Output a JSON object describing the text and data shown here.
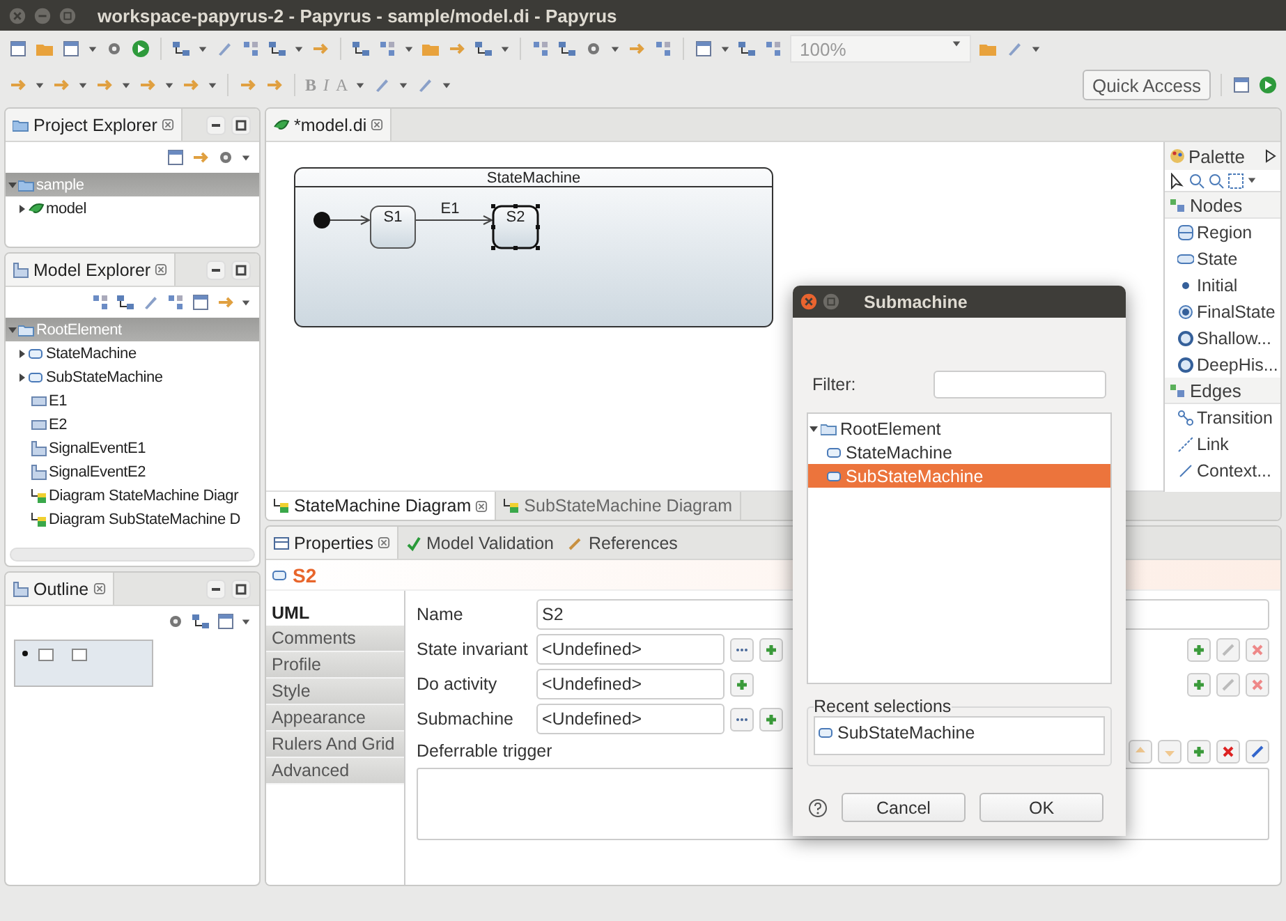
{
  "window": {
    "title": "workspace-papyrus-2 - Papyrus - sample/model.di - Papyrus"
  },
  "toolbar": {
    "format_buttons": [
      "B",
      "I",
      "A"
    ],
    "zoom": "100%",
    "quick_access": "Quick Access"
  },
  "project_explorer": {
    "title": "Project Explorer",
    "tree": [
      {
        "label": "sample",
        "kind": "project",
        "selected": true,
        "expanded": true,
        "children": [
          {
            "label": "model",
            "kind": "model",
            "selected": false,
            "expanded": false
          }
        ]
      }
    ]
  },
  "model_explorer": {
    "title": "Model Explorer",
    "tree": [
      {
        "label": "RootElement",
        "kind": "package",
        "selected": true,
        "expanded": true,
        "children": [
          {
            "label": "StateMachine",
            "kind": "statemachine",
            "selected": false,
            "expanded": false
          },
          {
            "label": "SubStateMachine",
            "kind": "statemachine",
            "selected": false,
            "expanded": false
          },
          {
            "label": "E1",
            "kind": "event",
            "selected": false
          },
          {
            "label": "E2",
            "kind": "event",
            "selected": false
          },
          {
            "label": "SignalEventE1",
            "kind": "signal",
            "selected": false
          },
          {
            "label": "SignalEventE2",
            "kind": "signal",
            "selected": false
          },
          {
            "label": "Diagram StateMachine Diagr",
            "kind": "diagram",
            "selected": false
          },
          {
            "label": "Diagram SubStateMachine D",
            "kind": "diagram",
            "selected": false
          }
        ]
      }
    ]
  },
  "outline": {
    "title": "Outline"
  },
  "editor": {
    "tab": "*model.di",
    "diagram": {
      "machine": "StateMachine",
      "transition": "E1",
      "states": [
        {
          "name": "S1",
          "selected": false
        },
        {
          "name": "S2",
          "selected": true
        }
      ]
    },
    "diagram_tabs": [
      {
        "label": "StateMachine Diagram",
        "selected": true
      },
      {
        "label": "SubStateMachine Diagram",
        "selected": false
      }
    ]
  },
  "palette": {
    "title": "Palette",
    "sections": [
      {
        "title": "Nodes",
        "items": [
          {
            "label": "Region",
            "kind": "region"
          },
          {
            "label": "State",
            "kind": "state"
          },
          {
            "label": "Initial",
            "kind": "initial"
          },
          {
            "label": "FinalState",
            "kind": "final"
          },
          {
            "label": "Shallow...",
            "kind": "history"
          },
          {
            "label": "DeepHis...",
            "kind": "history"
          }
        ]
      },
      {
        "title": "Edges",
        "items": [
          {
            "label": "Transition",
            "kind": "transition"
          },
          {
            "label": "Link",
            "kind": "link"
          },
          {
            "label": "Context...",
            "kind": "line"
          }
        ]
      }
    ]
  },
  "properties": {
    "tabs": [
      {
        "label": "Properties",
        "selected": true
      },
      {
        "label": "Model Validation",
        "selected": false
      },
      {
        "label": "References",
        "selected": false
      }
    ],
    "element": "S2",
    "categories": [
      {
        "label": "UML",
        "selected": true
      },
      {
        "label": "Comments",
        "selected": false
      },
      {
        "label": "Profile",
        "selected": false
      },
      {
        "label": "Style",
        "selected": false
      },
      {
        "label": "Appearance",
        "selected": false
      },
      {
        "label": "Rulers And Grid",
        "selected": false
      },
      {
        "label": "Advanced",
        "selected": false
      }
    ],
    "fields": [
      {
        "label": "Name",
        "value": "S2",
        "kind": "text"
      },
      {
        "label": "State invariant",
        "value": "<Undefined>",
        "kind": "reference"
      },
      {
        "label": "Do activity",
        "value": "<Undefined>",
        "kind": "behavior"
      },
      {
        "label": "Submachine",
        "value": "<Undefined>",
        "kind": "reference"
      }
    ],
    "list_label": "Deferrable trigger"
  },
  "dialog": {
    "title": "Submachine",
    "filter_label": "Filter:",
    "tree": [
      {
        "label": "RootElement",
        "selected": false,
        "expanded": true,
        "children": [
          {
            "label": "StateMachine",
            "selected": false
          },
          {
            "label": "SubStateMachine",
            "selected": true
          }
        ]
      }
    ],
    "recent_label": "Recent selections",
    "recent": [
      "SubStateMachine"
    ],
    "buttons": [
      "Cancel",
      "OK"
    ]
  }
}
